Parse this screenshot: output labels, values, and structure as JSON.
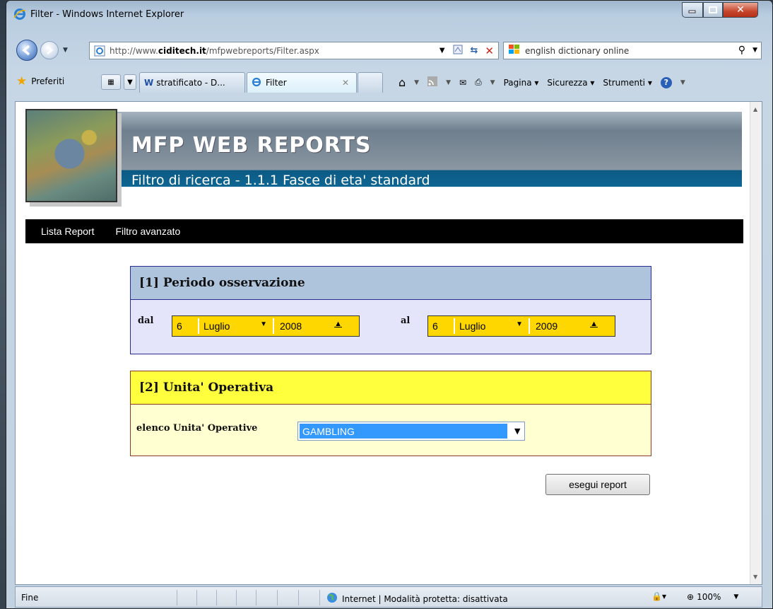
{
  "window": {
    "title": "Filter - Windows Internet Explorer"
  },
  "address": {
    "url_prefix": "http://www.",
    "url_domain": "ciditech.it",
    "url_path": "/mfpwebreports/Filter.aspx"
  },
  "search": {
    "text": "english dictionary online"
  },
  "toolbar": {
    "favorites_label": "Preferiti",
    "tabs": [
      {
        "label": "stratificato - D..."
      },
      {
        "label": "Filter"
      }
    ],
    "pagina_label": "Pagina",
    "sicurezza_label": "Sicurezza",
    "strumenti_label": "Strumenti"
  },
  "page": {
    "site_title": "MFP WEB REPORTS",
    "subtitle": "Filtro di ricerca - 1.1.1 Fasce di eta' standard",
    "menu": [
      {
        "label": "Lista Report"
      },
      {
        "label": "Filtro avanzato"
      }
    ],
    "periodo": {
      "heading": "[1] Periodo osservazione",
      "from_label": "dal",
      "from_day": "6",
      "from_month": "Luglio",
      "from_year": "2008",
      "to_label": "al",
      "to_day": "6",
      "to_month": "Luglio",
      "to_year": "2009"
    },
    "unita": {
      "heading": "[2] Unita' Operativa",
      "list_label": "elenco Unita' Operative",
      "selected": "GAMBLING"
    },
    "run_button": "esegui report"
  },
  "statusbar": {
    "status": "Fine",
    "zone": "Internet | Modalità protetta: disattivata",
    "zoom": "100%"
  },
  "colors": {
    "periodo_header": "#aec3dc",
    "periodo_body": "#e4e5fb",
    "unita_header": "#ffff3d",
    "unita_body": "#ffffd1",
    "date_fill": "#ffd700",
    "select_highlight": "#3399ff",
    "menu_bg": "#000000"
  }
}
